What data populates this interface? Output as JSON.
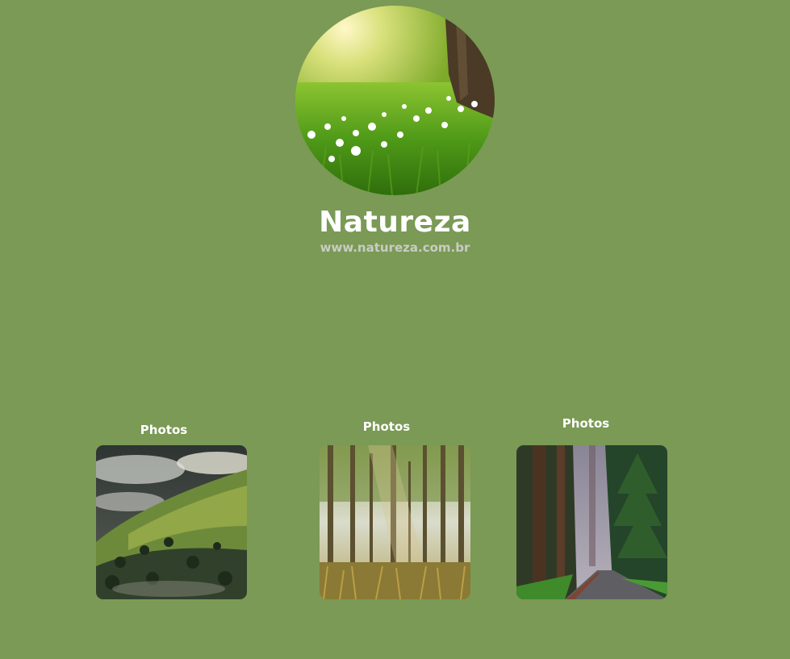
{
  "profile": {
    "avatar_icon": "meadow-tree-avatar-image",
    "name": "Natureza",
    "website": "www.natureza.com.br"
  },
  "gallery": [
    {
      "label": "Photos",
      "image_icon": "misty-hills-photo"
    },
    {
      "label": "Photos",
      "image_icon": "forest-light-photo"
    },
    {
      "label": "Photos",
      "image_icon": "forest-road-photo"
    }
  ],
  "colors": {
    "background": "#7a9a55",
    "title_text": "#ffffff",
    "subtitle_text": "#c9ccc4"
  }
}
